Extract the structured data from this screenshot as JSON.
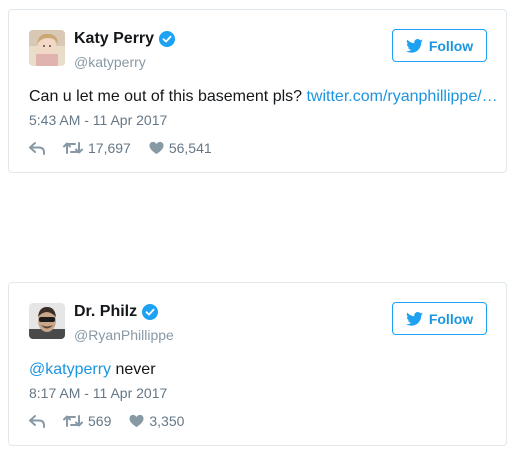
{
  "tweets": [
    {
      "name": "Katy Perry",
      "handle": "@katyperry",
      "follow_label": "Follow",
      "text_plain": "Can u let me out of this basement pls? ",
      "text_link": "twitter.com/ryanphillippe/…",
      "timestamp": "5:43 AM - 11 Apr 2017",
      "retweets": "17,697",
      "likes": "56,541"
    },
    {
      "name": "Dr. Philz",
      "handle": "@RyanPhillippe",
      "follow_label": "Follow",
      "text_mention": "@katyperry",
      "text_plain": " never",
      "timestamp": "8:17 AM - 11 Apr 2017",
      "retweets": "569",
      "likes": "3,350"
    }
  ],
  "colors": {
    "accent": "#1da1f2",
    "link": "#1b95e0",
    "muted": "#657786",
    "border": "#e1e8ed"
  },
  "icons": [
    "verified-badge-icon",
    "twitter-bird-icon",
    "reply-icon",
    "retweet-icon",
    "like-heart-icon"
  ]
}
